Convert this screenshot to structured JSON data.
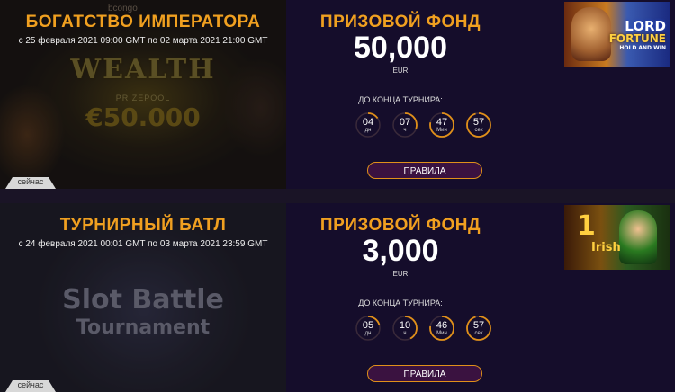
{
  "tournaments": [
    {
      "title": "БОГАТСТВО ИМПЕРАТОРА",
      "dates": "с 25 февраля 2021 09:00 GMT по 02 марта 2021 21:00 GMT",
      "badge": "сейчас",
      "prize_heading": "ПРИЗОВОЙ ФОНД",
      "prize_amount": "50,000",
      "currency": "EUR",
      "till_end_label": "ДО КОНЦА ТУРНИРА:",
      "timer": [
        {
          "value": "04",
          "unit": "дн",
          "fraction": 0.15
        },
        {
          "value": "07",
          "unit": "ч",
          "fraction": 0.3
        },
        {
          "value": "47",
          "unit": "Мин",
          "fraction": 0.78
        },
        {
          "value": "57",
          "unit": "сек",
          "fraction": 0.95
        }
      ],
      "rules_button": "ПРАВИЛА",
      "art": {
        "brand": "bcongo",
        "logo": "WEALTH",
        "prizepool_label": "PRIZEPOOL",
        "prizepool_amount": "€50.000"
      },
      "thumb": {
        "line1": "LORD",
        "line2": "FORTUNE",
        "line3": "HOLD AND WIN"
      }
    },
    {
      "title": "ТУРНИРНЫЙ БАТЛ",
      "dates": "с 24 февраля 2021 00:01 GMT по 03 марта 2021 23:59 GMT",
      "badge": "сейчас",
      "prize_heading": "ПРИЗОВОЙ ФОНД",
      "prize_amount": "3,000",
      "currency": "EUR",
      "till_end_label": "ДО КОНЦА ТУРНИРА:",
      "timer": [
        {
          "value": "05",
          "unit": "дн",
          "fraction": 0.2
        },
        {
          "value": "10",
          "unit": "ч",
          "fraction": 0.42
        },
        {
          "value": "46",
          "unit": "Мин",
          "fraction": 0.77
        },
        {
          "value": "57",
          "unit": "сек",
          "fraction": 0.95
        }
      ],
      "rules_button": "ПРАВИЛА",
      "art": {
        "logo_line1": "Slot Battle",
        "logo_line2": "Tournament"
      },
      "thumb": {
        "line1": "1",
        "line2": "Irish"
      }
    }
  ],
  "colors": {
    "accent": "#f0a020",
    "panel_bg": "#150d2b",
    "button_bg": "#3a1240",
    "ring_active": "#e0901a",
    "ring_track": "#3a2a3a"
  }
}
